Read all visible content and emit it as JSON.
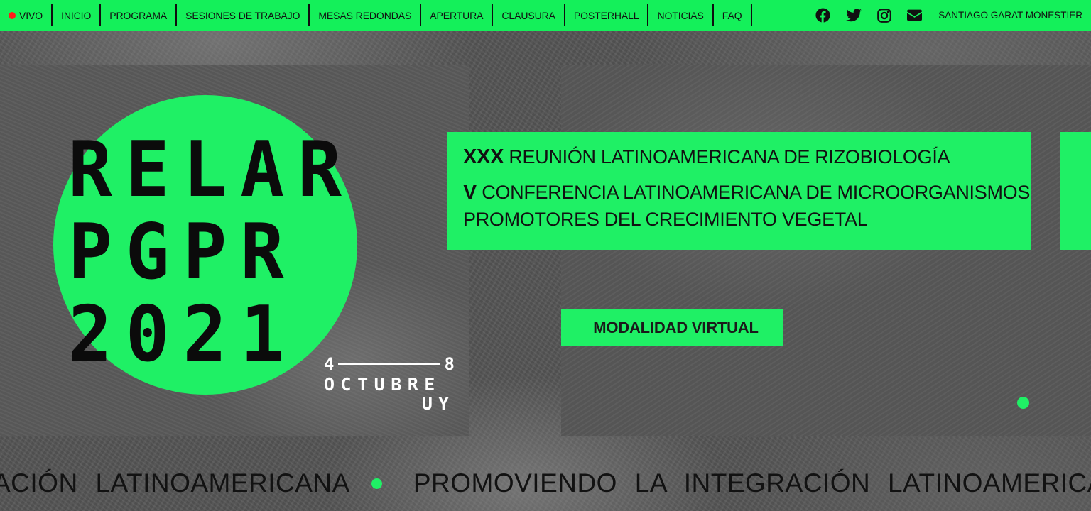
{
  "nav": {
    "live_label": "VIVO",
    "items": [
      {
        "id": "inicio",
        "label": "INICIO"
      },
      {
        "id": "programa",
        "label": "PROGRAMA"
      },
      {
        "id": "sesiones",
        "label": "SESIONES DE TRABAJO"
      },
      {
        "id": "mesas",
        "label": "MESAS REDONDAS"
      },
      {
        "id": "apertura",
        "label": "APERTURA"
      },
      {
        "id": "clausura",
        "label": "CLAUSURA"
      },
      {
        "id": "posterhall",
        "label": "POSTERHALL"
      },
      {
        "id": "noticias",
        "label": "NOTICIAS"
      },
      {
        "id": "faq",
        "label": "FAQ"
      }
    ],
    "social_icons": [
      "facebook-icon",
      "twitter-icon",
      "instagram-icon",
      "envelope-icon"
    ],
    "user_name": "SANTIAGO GARAT MONESTIER"
  },
  "hero": {
    "logo_lines": [
      "RELAR",
      "PGPR",
      "2021"
    ],
    "date_start": "4",
    "date_end": "8",
    "month": "OCTUBRE",
    "country": "UY",
    "title_l1_bold": "XXX",
    "title_l1_rest": " REUNIÓN LATINOAMERICANA DE RIZOBIOLOGÍA",
    "title_l2_bold": "V",
    "title_l2_rest": " CONFERENCIA LATINOAMERICANA DE MICROORGANISMOS",
    "title_l3": "PROMOTORES DEL CRECIMIENTO VEGETAL",
    "modality": "MODALIDAD VIRTUAL"
  },
  "marquee": {
    "segment_1": "ACIÓN LATINOAMERICANA",
    "segment_2": "PROMOVIENDO LA INTEGRACIÓN LATINOAMERICANA"
  },
  "colors": {
    "accent_green": "#1ff065",
    "nav_green": "#14f05a",
    "live_red": "#ff1a1a"
  }
}
